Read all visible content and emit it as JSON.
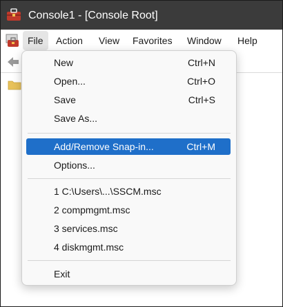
{
  "window": {
    "title": "Console1 - [Console Root]"
  },
  "colors": {
    "titlebar_bg": "#3b3b3b",
    "highlight_bg": "#1f6fc9",
    "menu_bg": "#f9f9f9"
  },
  "menubar": {
    "items": [
      {
        "label": "File",
        "active": true
      },
      {
        "label": "Action",
        "active": false
      },
      {
        "label": "View",
        "active": false
      },
      {
        "label": "Favorites",
        "active": false
      },
      {
        "label": "Window",
        "active": false
      },
      {
        "label": "Help",
        "active": false
      }
    ]
  },
  "icons": {
    "app": "mmc-toolbox-icon",
    "back": "back-arrow-icon",
    "folder": "folder-icon"
  },
  "file_menu": {
    "groups": [
      [
        {
          "label": "New",
          "shortcut": "Ctrl+N"
        },
        {
          "label": "Open...",
          "shortcut": "Ctrl+O"
        },
        {
          "label": "Save",
          "shortcut": "Ctrl+S"
        },
        {
          "label": "Save As...",
          "shortcut": ""
        }
      ],
      [
        {
          "label": "Add/Remove Snap-in...",
          "shortcut": "Ctrl+M",
          "highlighted": true
        },
        {
          "label": "Options...",
          "shortcut": ""
        }
      ],
      [
        {
          "label": "1 C:\\Users\\...\\SSCM.msc",
          "shortcut": ""
        },
        {
          "label": "2 compmgmt.msc",
          "shortcut": ""
        },
        {
          "label": "3 services.msc",
          "shortcut": ""
        },
        {
          "label": "4 diskmgmt.msc",
          "shortcut": ""
        }
      ],
      [
        {
          "label": "Exit",
          "shortcut": ""
        }
      ]
    ]
  }
}
